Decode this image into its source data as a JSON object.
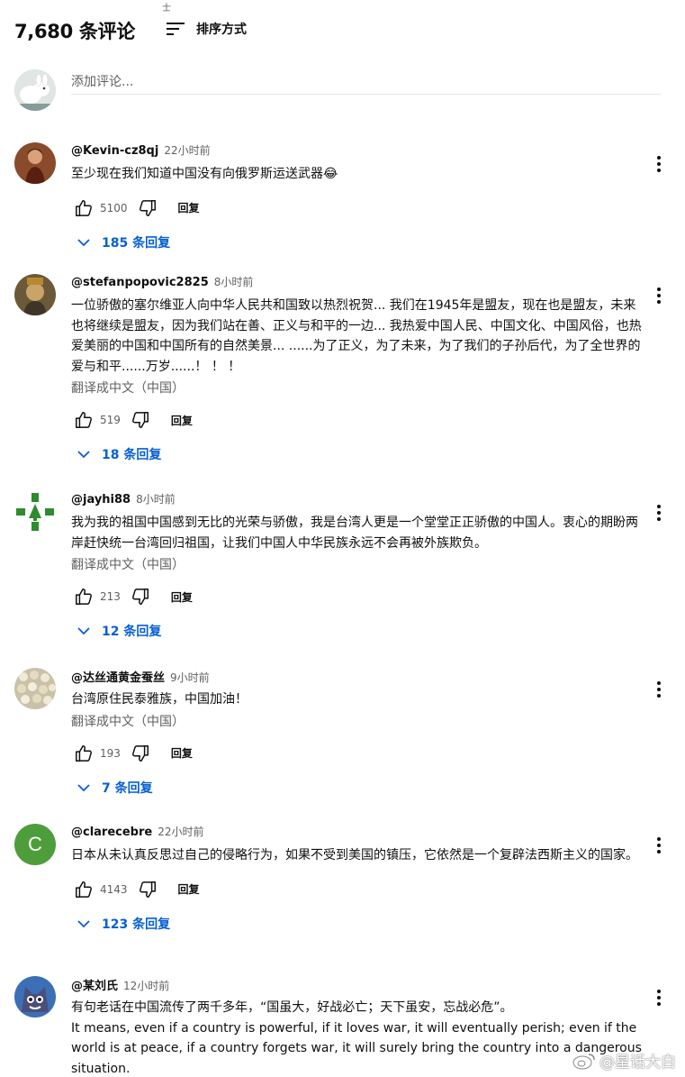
{
  "header": {
    "count_label": "7,680 条评论",
    "sort_label": "排序方式",
    "top_glyph": "士"
  },
  "add_comment": {
    "placeholder": "添加评论..."
  },
  "comments": [
    {
      "author": "@Kevin-cz8qj",
      "time": "22小时前",
      "text": "至少现在我们知道中国没有向俄罗斯运送武器😂",
      "translate": "",
      "likes": "5100",
      "reply": "回复",
      "replies": "185 条回复"
    },
    {
      "author": "@stefanpopovic2825",
      "time": "8小时前",
      "text": "一位骄傲的塞尔维亚人向中华人民共和国致以热烈祝贺... 我们在1945年是盟友，现在也是盟友，未来也将继续是盟友，因为我们站在善、正义与和平的一边... 我热爱中国人民、中国文化、中国风俗，也热爱美丽的中国和中国所有的自然美景... ......为了正义，为了未来，为了我们的子孙后代，为了全世界的爱与和平......万岁......！ ！ ！",
      "translate": "翻译成中文（中国）",
      "likes": "519",
      "reply": "回复",
      "replies": "18 条回复"
    },
    {
      "author": "@jayhi88",
      "time": "8小时前",
      "text": "我为我的祖国中国感到无比的光荣与骄傲，我是台湾人更是一个堂堂正正骄傲的中国人。衷心的期盼两岸赶快统一台湾回归祖国，让我们中国人中华民族永远不会再被外族欺负。",
      "translate": "翻译成中文（中国）",
      "likes": "213",
      "reply": "回复",
      "replies": "12 条回复"
    },
    {
      "author": "@达丝通黄金蚕丝",
      "time": "9小时前",
      "text": "台湾原住民泰雅族，中国加油！",
      "translate": "翻译成中文（中国）",
      "likes": "193",
      "reply": "回复",
      "replies": "7 条回复"
    },
    {
      "author": "@clarecebre",
      "time": "22小时前",
      "text": "日本从未认真反思过自己的侵略行为，如果不受到美国的镇压，它依然是一个复辟法西斯主义的国家。",
      "translate": "",
      "likes": "4143",
      "reply": "回复",
      "replies": "123 条回复",
      "avatar_letter": "C"
    },
    {
      "author": "@某刘氏",
      "time": "12小时前",
      "text": "有句老话在中国流传了两千多年，“国虽大，好战必亡；天下虽安，忘战必危”。\nIt means, even if a country is powerful, if it loves war, it will eventually perish; even if the world is at peace, if a country forgets war, it will surely bring the country into a dangerous situation.",
      "translate": "",
      "likes": "",
      "reply": "",
      "replies": ""
    }
  ],
  "watermark": "@星话大白",
  "colors": {
    "link_blue": "#065fd4",
    "secondary_text": "#606060",
    "avatar_green": "#4d9e3a"
  }
}
